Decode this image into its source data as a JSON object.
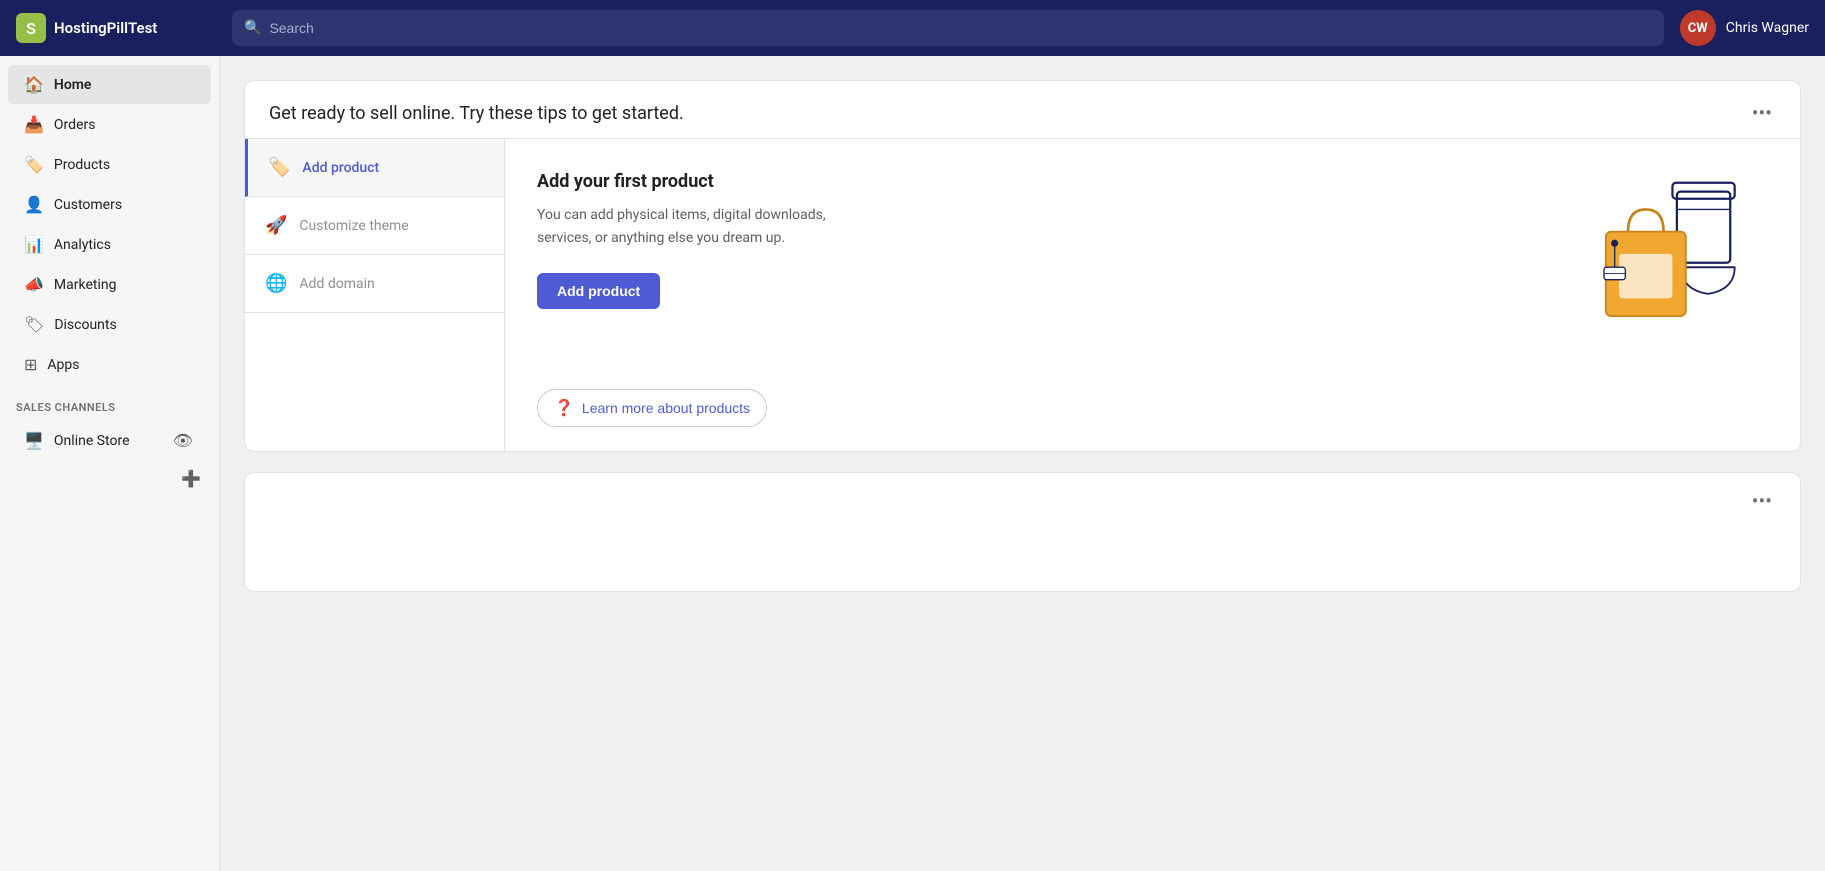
{
  "topnav": {
    "brand_name": "HostingPillTest",
    "search_placeholder": "Search",
    "user_initials": "CW",
    "user_name": "Chris Wagner"
  },
  "sidebar": {
    "items": [
      {
        "id": "home",
        "label": "Home",
        "icon": "🏠",
        "active": true
      },
      {
        "id": "orders",
        "label": "Orders",
        "icon": "📥"
      },
      {
        "id": "products",
        "label": "Products",
        "icon": "🏷️"
      },
      {
        "id": "customers",
        "label": "Customers",
        "icon": "👤"
      },
      {
        "id": "analytics",
        "label": "Analytics",
        "icon": "📊"
      },
      {
        "id": "marketing",
        "label": "Marketing",
        "icon": "📣"
      },
      {
        "id": "discounts",
        "label": "Discounts",
        "icon": "🏷"
      },
      {
        "id": "apps",
        "label": "Apps",
        "icon": "⊞"
      }
    ],
    "sales_channels_label": "SALES CHANNELS",
    "online_store_label": "Online Store",
    "add_channel_icon": "➕",
    "eye_icon": "👁"
  },
  "main_card": {
    "title": "Get ready to sell online. Try these tips to get started.",
    "three_dots_label": "•••"
  },
  "steps": [
    {
      "id": "add-product",
      "label": "Add product",
      "icon": "🏷️",
      "active": true
    },
    {
      "id": "customize-theme",
      "label": "Customize theme",
      "icon": "🚀",
      "active": false
    },
    {
      "id": "add-domain",
      "label": "Add domain",
      "icon": "🌐",
      "active": false
    }
  ],
  "step_content": {
    "title": "Add your first product",
    "description": "You can add physical items, digital downloads, services, or anything else you dream up.",
    "cta_label": "Add product",
    "learn_more_label": "Learn more about products"
  },
  "second_card": {
    "three_dots_label": "•••"
  }
}
